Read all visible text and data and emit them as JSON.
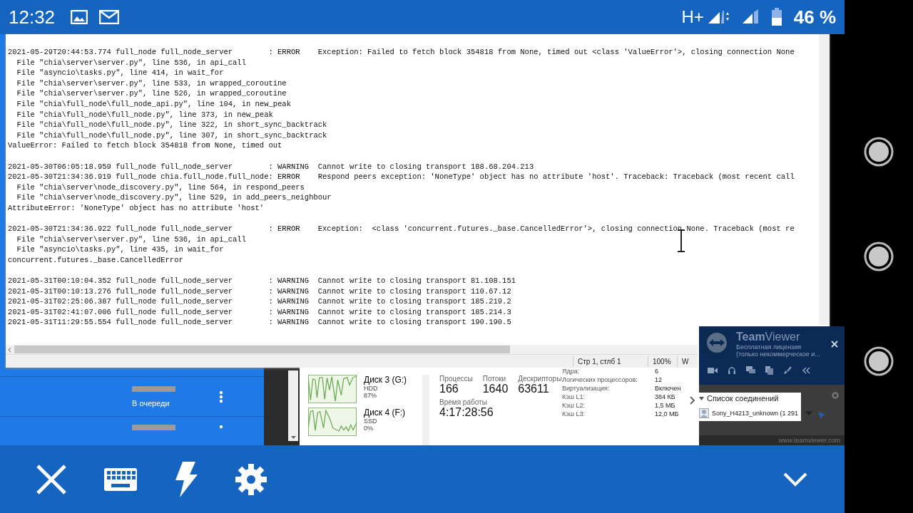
{
  "status_bar": {
    "time": "12:32",
    "network": "H+",
    "battery": "46 %"
  },
  "notepad": {
    "log": [
      {
        "lines": [
          "2021-05-29T20:44:53.774 full_node full_node_server        : ERROR    Exception: Failed to fetch block 354818 from None, timed out <class 'ValueError'>, closing connection None",
          "  File \"chia\\server\\server.py\", line 536, in api_call",
          "  File \"asyncio\\tasks.py\", line 414, in wait_for",
          "  File \"chia\\server\\server.py\", line 533, in wrapped_coroutine",
          "  File \"chia\\server\\server.py\", line 526, in wrapped_coroutine",
          "  File \"chia\\full_node\\full_node_api.py\", line 104, in new_peak",
          "  File \"chia\\full_node\\full_node.py\", line 373, in new_peak",
          "  File \"chia\\full_node\\full_node.py\", line 322, in short_sync_backtrack",
          "  File \"chia\\full_node\\full_node.py\", line 307, in short_sync_backtrack",
          "ValueError: Failed to fetch block 354818 from None, timed out"
        ]
      },
      {
        "lines": [
          "2021-05-30T06:05:18.959 full_node full_node_server        : WARNING  Cannot write to closing transport 188.68.204.213",
          "2021-05-30T21:34:36.919 full_node chia.full_node.full_node: ERROR    Respond peers exception: 'NoneType' object has no attribute 'host'. Traceback: Traceback (most recent call",
          "  File \"chia\\server\\node_discovery.py\", line 564, in respond_peers",
          "  File \"chia\\server\\node_discovery.py\", line 529, in add_peers_neighbour",
          "AttributeError: 'NoneType' object has no attribute 'host'"
        ]
      },
      {
        "lines": [
          "2021-05-30T21:34:36.922 full_node full_node_server        : ERROR    Exception:  <class 'concurrent.futures._base.CancelledError'>, closing connection None. Traceback (most re",
          "  File \"chia\\server\\server.py\", line 536, in api_call",
          "  File \"asyncio\\tasks.py\", line 435, in wait_for",
          "concurrent.futures._base.CancelledError"
        ]
      },
      {
        "lines": [
          "2021-05-31T00:10:04.352 full_node full_node_server        : WARNING  Cannot write to closing transport 81.108.151",
          "2021-05-31T00:10:13.276 full_node full_node_server        : WARNING  Cannot write to closing transport 110.67.12",
          "2021-05-31T02:25:06.387 full_node full_node_server        : WARNING  Cannot write to closing transport 185.219.2",
          "2021-05-31T02:41:07.006 full_node full_node_server        : WARNING  Cannot write to closing transport 185.214.3",
          "2021-05-31T11:29:55.554 full_node full_node_server        : WARNING  Cannot write to closing transport 190.190.5"
        ]
      }
    ],
    "status": [
      "Стр 1, стлб 1",
      "100%",
      "W"
    ]
  },
  "queue": {
    "status": "В очереди"
  },
  "disks": [
    {
      "name": "Диск 3 (G:)",
      "type": "HDD",
      "usage": "87%"
    },
    {
      "name": "Диск 4 (F:)",
      "type": "SSD",
      "usage": "0%"
    }
  ],
  "stats": [
    {
      "label": "Процессы",
      "value": "166"
    },
    {
      "label": "Потоки",
      "value": "1640"
    },
    {
      "label": "Дескрипторы",
      "value": "63611"
    }
  ],
  "uptime": {
    "label": "Время работы",
    "value": "4:17:28:56"
  },
  "cpu_info": [
    {
      "label": "Ядра:",
      "value": "6"
    },
    {
      "label": "Логических процессоров:",
      "value": "12"
    },
    {
      "label": "Виртуализация:",
      "value": "Включен"
    },
    {
      "label": "Кэш L1:",
      "value": "384 КБ"
    },
    {
      "label": "Кэш L2:",
      "value": "1,5 МБ"
    },
    {
      "label": "Кэш L3:",
      "value": "12,0 МБ"
    }
  ],
  "teamviewer": {
    "title_bold": "Team",
    "title_rest": "Viewer",
    "license": "Бесплатная лицензия",
    "license_note": "(только некоммерческое и...",
    "list_title": "Список соединений",
    "connection": "Sony_H4213_unknown (1 291",
    "footer": "www.teamviewer.com"
  }
}
